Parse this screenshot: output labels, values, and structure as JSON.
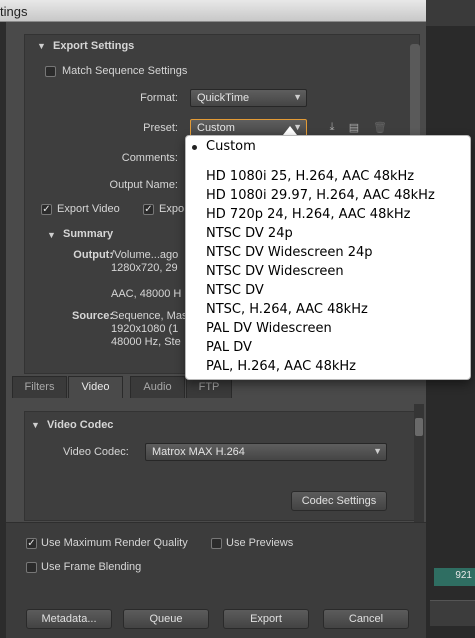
{
  "window": {
    "title": "tings"
  },
  "export_settings": {
    "section_title": "Export Settings",
    "match_sequence_label": "Match Sequence Settings",
    "format_label": "Format:",
    "format_value": "QuickTime",
    "preset_label": "Preset:",
    "preset_value": "Custom",
    "comments_label": "Comments:",
    "output_name_label": "Output Name:",
    "export_video_label": "Export Video",
    "export_audio_label": "Expo",
    "summary_title": "Summary",
    "output_label": "Output:",
    "output_lines": [
      "/Volume...ago",
      "1280x720, 29",
      "",
      "AAC, 48000 H"
    ],
    "source_label": "Source:",
    "source_lines": [
      "Sequence, Mas",
      "1920x1080 (1",
      "48000 Hz, Ste"
    ]
  },
  "tabs": [
    {
      "label": "Filters"
    },
    {
      "label": "Video"
    },
    {
      "label": "Audio"
    },
    {
      "label": "FTP"
    }
  ],
  "video": {
    "section_title": "Video Codec",
    "codec_label": "Video Codec:",
    "codec_value": "Matrox MAX H.264",
    "codec_settings_button": "Codec Settings"
  },
  "options": {
    "max_render_quality_label": "Use Maximum Render Quality",
    "use_previews_label": "Use Previews",
    "frame_blending_label": "Use Frame Blending"
  },
  "buttons": {
    "metadata": "Metadata...",
    "queue": "Queue",
    "export": "Export",
    "cancel": "Cancel"
  },
  "preset_menu": {
    "selected": "Custom",
    "items": [
      "HD 1080i 25, H.264, AAC 48kHz",
      "HD 1080i 29.97, H.264, AAC 48kHz",
      "HD 720p 24, H.264, AAC 48kHz",
      "NTSC DV 24p",
      "NTSC DV Widescreen 24p",
      "NTSC DV Widescreen",
      "NTSC DV",
      "NTSC, H.264, AAC 48kHz",
      "PAL DV Widescreen",
      "PAL DV",
      "PAL, H.264, AAC 48kHz"
    ]
  },
  "background": {
    "timecode_fragment": "921"
  },
  "colors": {
    "accent_orange": "#e39b36",
    "dialog_bg": "#4a4a4a",
    "timeline_teal": "#2f6e62"
  }
}
